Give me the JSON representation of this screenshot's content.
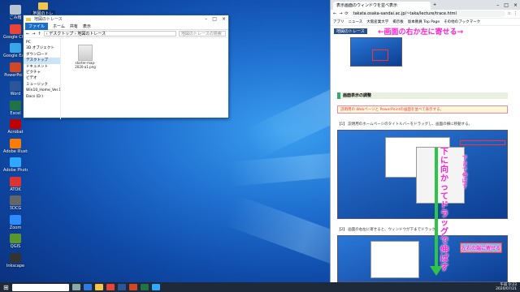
{
  "desktop": {
    "top_folder": "地図のトレース",
    "icons": [
      {
        "label": "ごみ箱",
        "color": "#b8c4d4"
      },
      {
        "label": "Google Chrome",
        "color": "#e9443a"
      },
      {
        "label": "Google Earth Pro",
        "color": "#3aa5e8"
      },
      {
        "label": "PowerPoint",
        "color": "#d24726"
      },
      {
        "label": "Word",
        "color": "#2b579a"
      },
      {
        "label": "Excel",
        "color": "#217346"
      },
      {
        "label": "Acrobat",
        "color": "#c00000"
      },
      {
        "label": "Adobe Illustrator",
        "color": "#ff7c00"
      },
      {
        "label": "Adobe Photoshop",
        "color": "#31a8ff"
      },
      {
        "label": "ATOK",
        "color": "#d33"
      },
      {
        "label": "3DCG",
        "color": "#666"
      },
      {
        "label": "Zoom",
        "color": "#2d8cff"
      },
      {
        "label": "QGIS",
        "color": "#589632"
      },
      {
        "label": "Inkscape",
        "color": "#333"
      }
    ]
  },
  "explorer": {
    "title": "地図のトレース",
    "ribbon": [
      "ファイル",
      "ホーム",
      "共有",
      "表示"
    ],
    "address": "› デスクトップ › 地図のトレース",
    "search_placeholder": "地図のトレースの検索",
    "nav": [
      "PC",
      "3D オブジェクト",
      "ダウンロード",
      "デスクトップ",
      "ドキュメント",
      "ピクチャ",
      "ビデオ",
      "ミュージック",
      "Win10_Home_Ver.1909 (C:)",
      "Docs (D:)"
    ],
    "nav_selected": 3,
    "file_name": "starter-map-2020-a1.png"
  },
  "browser": {
    "tab_title": "表示画面のウィンドウを並べ表示",
    "url": "takata.osaka-sandai.ac.jp/~taka/lecture/trace.html",
    "bookmarks": [
      "アプリ",
      "ニュース",
      "大阪産業大学",
      "掲示板",
      "坂本教員 Top Page",
      "その他のブックマーク"
    ],
    "page_title_small": "地図のトレース",
    "pink_top": "画面の右か左に寄せる",
    "arrow_right": "→",
    "arrow_left": "←",
    "section_heading": "画面表示の調整",
    "notice": "説明用の Webページと PowerPointの画面を並べて表示する。",
    "step1": "【1】 説明用のホームページのタイトルバーをドラッグし、画面の横に移動する。",
    "step2": "【2】 画面の右左に寄せると、ウィンドウが下までドラッグ…",
    "pink_vertical": "下に向かってドラッグで伸ばす",
    "pink_vertical_small": "下まで伸ばす",
    "pink_bottom": "左右の端に寄せる"
  },
  "taskbar": {
    "time": "午前 0:23",
    "date": "2020/07/21"
  }
}
